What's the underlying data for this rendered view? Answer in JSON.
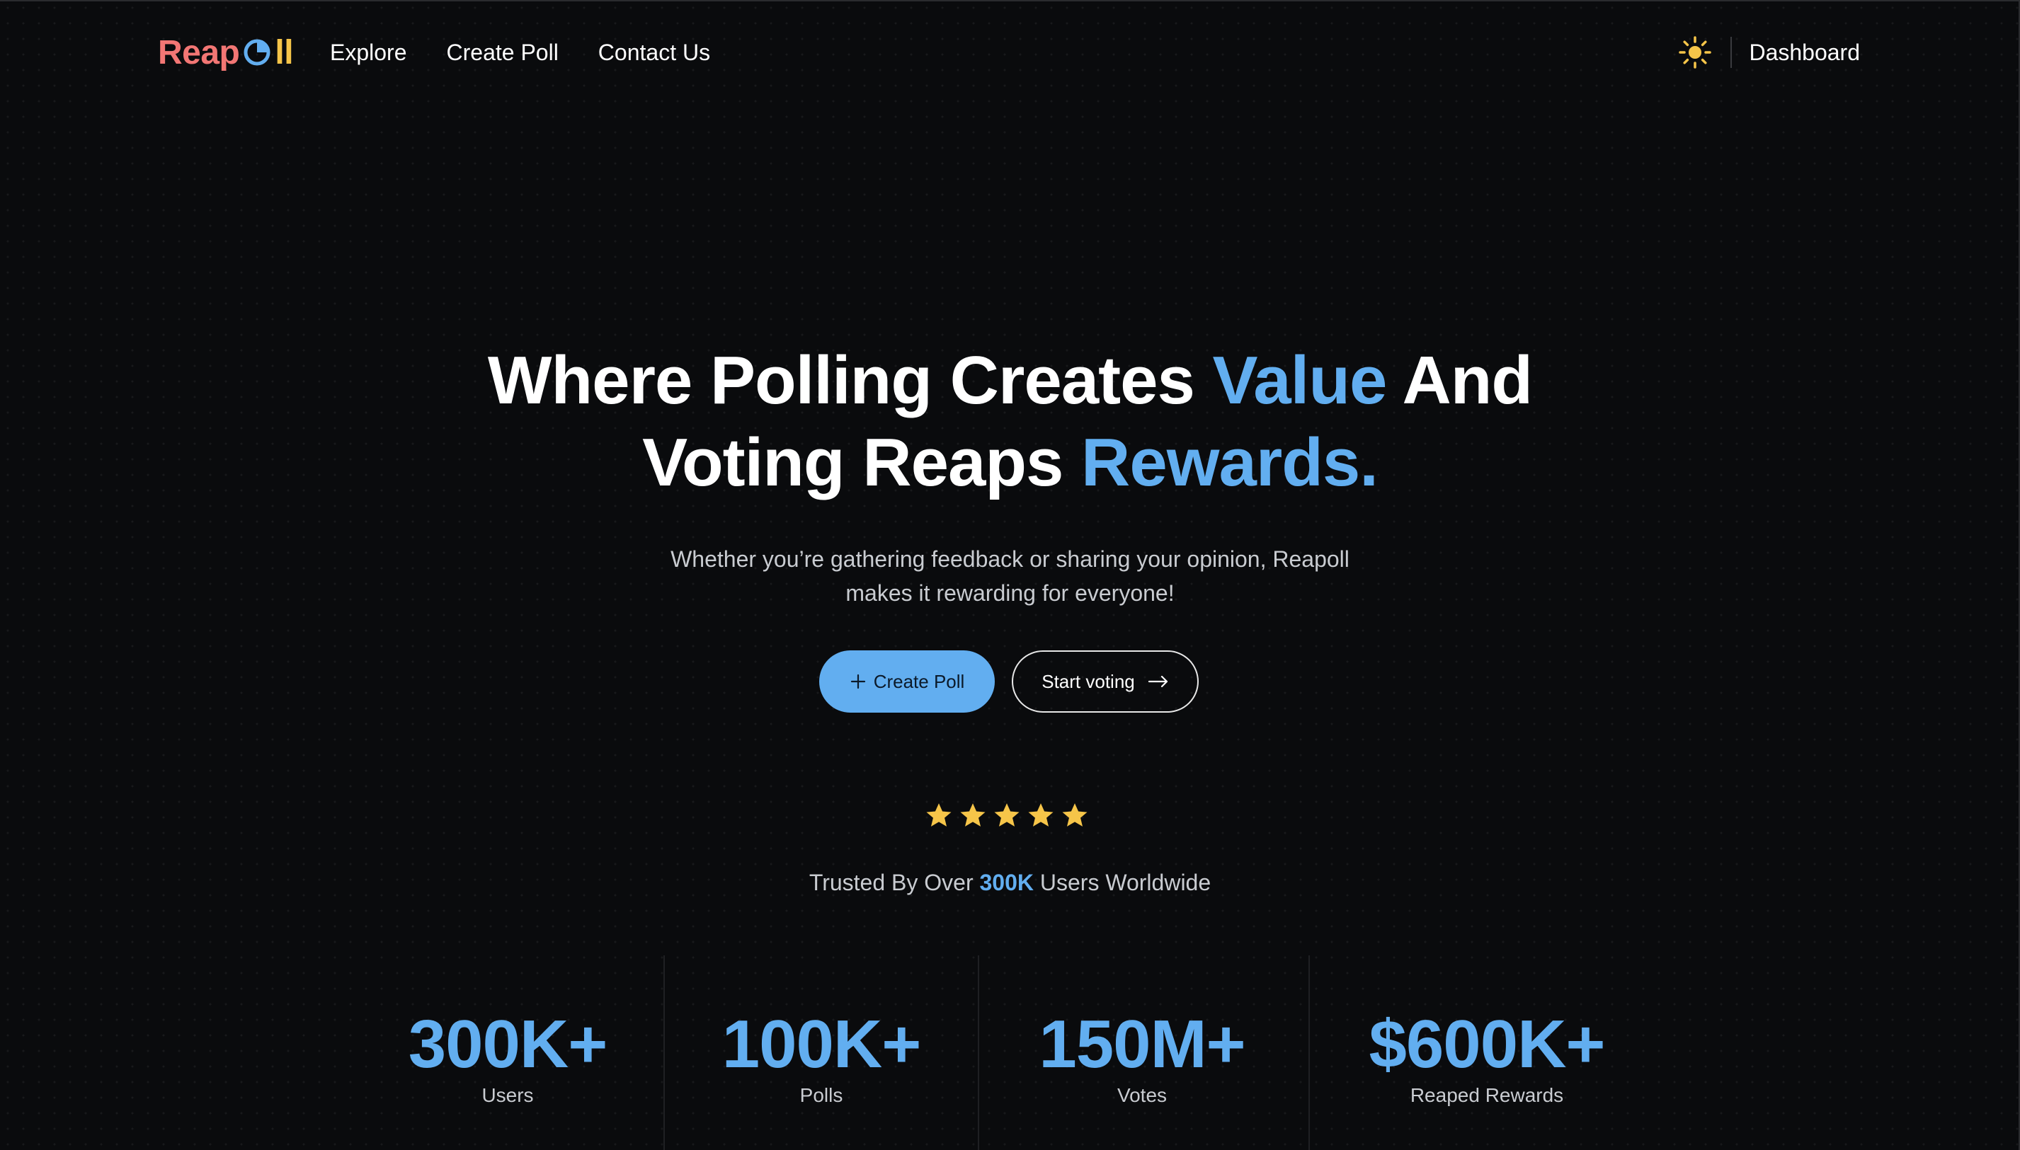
{
  "brand": {
    "name_part1": "Reap",
    "name_part2": "ll",
    "colors": {
      "reap": "#f27674",
      "ll": "#f6c549",
      "pie": "#62aef0"
    }
  },
  "nav": {
    "links": [
      {
        "label": "Explore"
      },
      {
        "label": "Create Poll"
      },
      {
        "label": "Contact Us"
      }
    ],
    "theme_icon": "sun-icon",
    "dashboard_label": "Dashboard"
  },
  "hero": {
    "title_line1_a": "Where Polling Creates ",
    "title_line1_accent": "Value",
    "title_line1_b": " And",
    "title_line2_a": "Voting Reaps ",
    "title_line2_accent": "Rewards.",
    "subtitle_line1": "Whether you’re gathering feedback or sharing your opinion, Reapoll",
    "subtitle_line2": "makes it rewarding for everyone!",
    "primary_button": "Create Poll",
    "secondary_button": "Start voting",
    "accent_color": "#62aef0"
  },
  "rating": {
    "stars": 5,
    "trusted_prefix": "Trusted By Over ",
    "trusted_highlight": "300K",
    "trusted_suffix": " Users Worldwide",
    "star_color": "#f6c549"
  },
  "stats": [
    {
      "value": "300K+",
      "label": "Users"
    },
    {
      "value": "100K+",
      "label": "Polls"
    },
    {
      "value": "150M+",
      "label": "Votes"
    },
    {
      "value": "$600K+",
      "label": "Reaped Rewards"
    }
  ]
}
